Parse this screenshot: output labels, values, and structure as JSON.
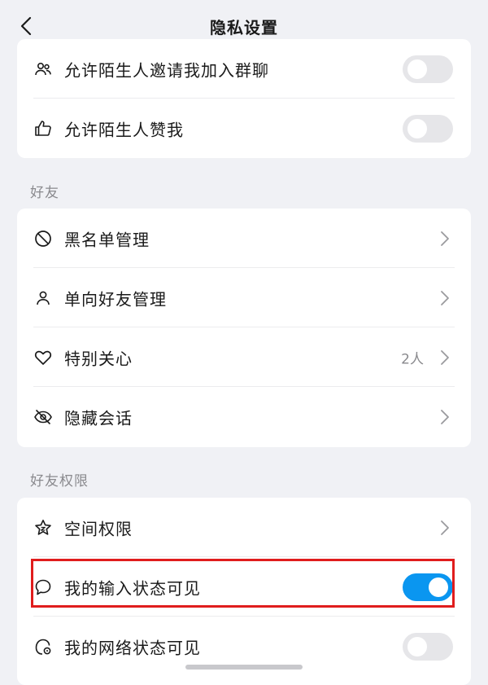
{
  "header": {
    "title": "隐私设置",
    "back_icon": "back-chevron-icon"
  },
  "card_top": {
    "items": [
      {
        "label": "允许陌生人邀请我加入群聊",
        "icon": "people-icon",
        "toggle_on": false
      },
      {
        "label": "允许陌生人赞我",
        "icon": "thumbs-up-icon",
        "toggle_on": false
      }
    ]
  },
  "friends": {
    "section_title": "好友",
    "items": [
      {
        "label": "黑名单管理",
        "icon": "block-icon"
      },
      {
        "label": "单向好友管理",
        "icon": "person-icon"
      },
      {
        "label": "特别关心",
        "icon": "heart-icon",
        "count": "2人"
      },
      {
        "label": "隐藏会话",
        "icon": "eye-hidden-icon"
      }
    ]
  },
  "friend_permissions": {
    "section_title": "好友权限",
    "items": [
      {
        "label": "空间权限",
        "icon": "star-icon"
      },
      {
        "label": "我的输入状态可见",
        "icon": "chat-bubble-icon",
        "toggle_on": true
      },
      {
        "label": "我的网络状态可见",
        "icon": "network-status-icon",
        "toggle_on": false
      }
    ]
  },
  "colors": {
    "accent": "#0a96f0",
    "highlight": "#e01d1d",
    "background": "#f0f1f5"
  }
}
